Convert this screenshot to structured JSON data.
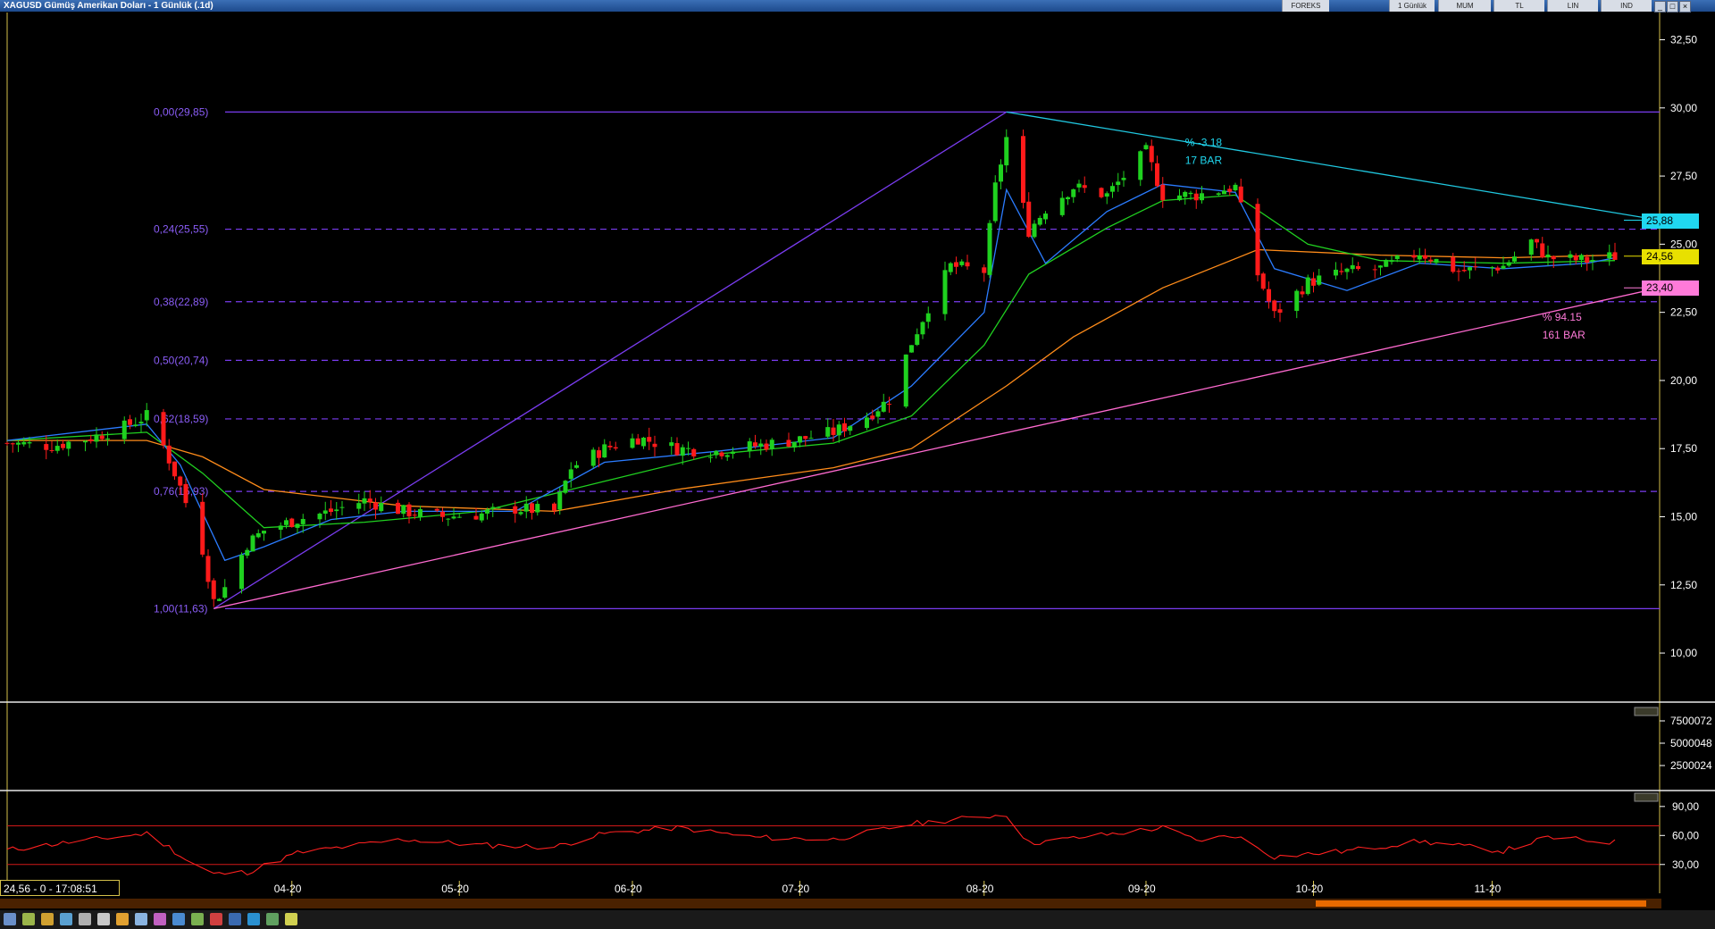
{
  "window": {
    "title": "XAGUSD Gümüş Amerikan Doları - 1 Günlük (.1d)",
    "menu": [
      "FOREKS",
      "1 Günlük",
      "MUM",
      "TL",
      "LIN",
      "IND"
    ]
  },
  "status": {
    "readout": "24,56 - 0 - 17:08:51"
  },
  "price_tags": [
    {
      "label": "25,88",
      "value": 25.88,
      "color": "#20d8f0"
    },
    {
      "label": "24,56",
      "value": 24.56,
      "color": "#e8e000"
    },
    {
      "label": "23,40",
      "value": 23.4,
      "color": "#ff7ad9"
    }
  ],
  "annotations": [
    {
      "line1": "% -3.18",
      "line2": "17 BAR",
      "color": "#20d8f0",
      "date": "2020-09-08",
      "price": 28.6
    },
    {
      "line1": "% 94.15",
      "line2": "161 BAR",
      "color": "#ff7ad9",
      "date": "2020-11-11",
      "price": 22.2
    }
  ],
  "chart_data": [
    {
      "type": "candlestick",
      "title": "",
      "x_ticks": [
        {
          "label": "04-20",
          "date": "2020-04-01"
        },
        {
          "label": "05-20",
          "date": "2020-05-01"
        },
        {
          "label": "06-20",
          "date": "2020-06-01"
        },
        {
          "label": "07-20",
          "date": "2020-07-01"
        },
        {
          "label": "08-20",
          "date": "2020-08-03"
        },
        {
          "label": "09-20",
          "date": "2020-09-01"
        },
        {
          "label": "10-20",
          "date": "2020-10-01"
        },
        {
          "label": "11-20",
          "date": "2020-11-02"
        }
      ],
      "xlim": [
        "2020-02-10",
        "2020-12-02"
      ],
      "y_ticks": [
        "32,50",
        "30,00",
        "27,50",
        "25,00",
        "22,50",
        "20,00",
        "17,50",
        "15,00",
        "12,50",
        "10,00"
      ],
      "y_tick_values": [
        32.5,
        30,
        27.5,
        25,
        22.5,
        20,
        17.5,
        15,
        12.5,
        10
      ],
      "ylim": [
        8.2,
        33.5
      ],
      "colors": {
        "up": "#1fd11f",
        "down": "#ff1a1a",
        "ema_fast": "#2b7cff",
        "ema_mid": "#20d020",
        "ema_slow": "#ff8c1a",
        "fib": "#7a3cf0",
        "support": "#ff6ad0",
        "resistance": "#20c8e0"
      },
      "closes": [
        [
          "2020-02-10",
          17.7
        ],
        [
          "2020-02-18",
          17.6
        ],
        [
          "2020-02-25",
          17.9
        ],
        [
          "2020-03-02",
          18.3
        ],
        [
          "2020-03-06",
          18.7
        ],
        [
          "2020-03-09",
          17.6
        ],
        [
          "2020-03-12",
          16.1
        ],
        [
          "2020-03-16",
          13.8
        ],
        [
          "2020-03-18",
          11.9
        ],
        [
          "2020-03-20",
          12.4
        ],
        [
          "2020-03-24",
          14.0
        ],
        [
          "2020-03-27",
          14.5
        ],
        [
          "2020-04-02",
          14.9
        ],
        [
          "2020-04-08",
          15.2
        ],
        [
          "2020-04-14",
          15.6
        ],
        [
          "2020-04-21",
          15.2
        ],
        [
          "2020-04-28",
          15.0
        ],
        [
          "2020-05-05",
          15.1
        ],
        [
          "2020-05-11",
          15.3
        ],
        [
          "2020-05-18",
          15.2
        ],
        [
          "2020-05-21",
          16.8
        ],
        [
          "2020-05-27",
          17.5
        ],
        [
          "2020-06-02",
          17.9
        ],
        [
          "2020-06-09",
          17.5
        ],
        [
          "2020-06-16",
          17.4
        ],
        [
          "2020-06-23",
          17.6
        ],
        [
          "2020-06-30",
          17.8
        ],
        [
          "2020-07-07",
          18.1
        ],
        [
          "2020-07-13",
          18.7
        ],
        [
          "2020-07-17",
          19.3
        ],
        [
          "2020-07-21",
          21.4
        ],
        [
          "2020-07-24",
          22.7
        ],
        [
          "2020-07-28",
          24.2
        ],
        [
          "2020-08-03",
          24.0
        ],
        [
          "2020-08-05",
          27.1
        ],
        [
          "2020-08-07",
          28.9
        ],
        [
          "2020-08-11",
          25.5
        ],
        [
          "2020-08-14",
          26.3
        ],
        [
          "2020-08-19",
          27.1
        ],
        [
          "2020-08-25",
          26.8
        ],
        [
          "2020-09-01",
          28.4
        ],
        [
          "2020-09-04",
          26.8
        ],
        [
          "2020-09-10",
          26.8
        ],
        [
          "2020-09-17",
          27.1
        ],
        [
          "2020-09-21",
          23.9
        ],
        [
          "2020-09-24",
          22.4
        ],
        [
          "2020-09-30",
          23.6
        ],
        [
          "2020-10-07",
          24.0
        ],
        [
          "2020-10-13",
          24.1
        ],
        [
          "2020-10-20",
          24.7
        ],
        [
          "2020-10-27",
          24.0
        ],
        [
          "2020-11-04",
          24.2
        ],
        [
          "2020-11-09",
          25.1
        ],
        [
          "2020-11-12",
          24.5
        ],
        [
          "2020-11-19",
          24.4
        ],
        [
          "2020-11-24",
          24.56
        ]
      ],
      "ema_fast": [
        [
          "2020-02-10",
          17.8
        ],
        [
          "2020-03-06",
          18.4
        ],
        [
          "2020-03-12",
          16.9
        ],
        [
          "2020-03-20",
          13.4
        ],
        [
          "2020-03-27",
          13.9
        ],
        [
          "2020-04-08",
          14.9
        ],
        [
          "2020-04-21",
          15.2
        ],
        [
          "2020-05-11",
          15.2
        ],
        [
          "2020-05-27",
          17.0
        ],
        [
          "2020-06-16",
          17.4
        ],
        [
          "2020-07-07",
          17.9
        ],
        [
          "2020-07-21",
          19.8
        ],
        [
          "2020-08-03",
          22.5
        ],
        [
          "2020-08-07",
          27.0
        ],
        [
          "2020-08-14",
          24.3
        ],
        [
          "2020-08-25",
          26.2
        ],
        [
          "2020-09-04",
          27.2
        ],
        [
          "2020-09-17",
          26.9
        ],
        [
          "2020-09-24",
          24.1
        ],
        [
          "2020-10-07",
          23.3
        ],
        [
          "2020-10-20",
          24.3
        ],
        [
          "2020-11-04",
          24.1
        ],
        [
          "2020-11-19",
          24.3
        ],
        [
          "2020-11-24",
          24.5
        ]
      ],
      "ema_mid": [
        [
          "2020-02-10",
          17.8
        ],
        [
          "2020-03-06",
          18.1
        ],
        [
          "2020-03-16",
          16.6
        ],
        [
          "2020-03-27",
          14.6
        ],
        [
          "2020-04-14",
          14.8
        ],
        [
          "2020-05-05",
          15.2
        ],
        [
          "2020-05-27",
          16.3
        ],
        [
          "2020-06-16",
          17.3
        ],
        [
          "2020-07-07",
          17.7
        ],
        [
          "2020-07-21",
          18.7
        ],
        [
          "2020-08-03",
          21.3
        ],
        [
          "2020-08-11",
          23.9
        ],
        [
          "2020-08-25",
          25.6
        ],
        [
          "2020-09-04",
          26.6
        ],
        [
          "2020-09-17",
          26.8
        ],
        [
          "2020-09-30",
          25.0
        ],
        [
          "2020-10-13",
          24.4
        ],
        [
          "2020-11-04",
          24.3
        ],
        [
          "2020-11-24",
          24.4
        ]
      ],
      "ema_slow": [
        [
          "2020-02-10",
          17.8
        ],
        [
          "2020-03-06",
          17.8
        ],
        [
          "2020-03-16",
          17.2
        ],
        [
          "2020-03-27",
          16.0
        ],
        [
          "2020-04-21",
          15.4
        ],
        [
          "2020-05-18",
          15.2
        ],
        [
          "2020-06-09",
          16.0
        ],
        [
          "2020-07-07",
          16.8
        ],
        [
          "2020-07-21",
          17.5
        ],
        [
          "2020-08-07",
          19.8
        ],
        [
          "2020-08-19",
          21.6
        ],
        [
          "2020-09-04",
          23.4
        ],
        [
          "2020-09-21",
          24.8
        ],
        [
          "2020-10-13",
          24.6
        ],
        [
          "2020-11-04",
          24.5
        ],
        [
          "2020-11-24",
          24.6
        ]
      ],
      "fibonacci": [
        {
          "label": "0,00(29,85)",
          "value": 29.85
        },
        {
          "label": "0,24(25,55)",
          "value": 25.55
        },
        {
          "label": "0,38(22,89)",
          "value": 22.89
        },
        {
          "label": "0,50(20,74)",
          "value": 20.74
        },
        {
          "label": "0,62(18,59)",
          "value": 18.59
        },
        {
          "label": "0,76(15,93)",
          "value": 15.93
        },
        {
          "label": "1,00(11,63)",
          "value": 11.63
        }
      ],
      "trendlines": [
        {
          "kind": "fib-swing",
          "from": [
            "2020-03-18",
            11.63
          ],
          "to": [
            "2020-08-07",
            29.85
          ]
        },
        {
          "kind": "support",
          "from": [
            "2020-03-18",
            11.63
          ],
          "to": [
            "2020-12-02",
            23.4
          ]
        },
        {
          "kind": "resistance",
          "from": [
            "2020-08-07",
            29.85
          ],
          "to": [
            "2020-12-02",
            25.88
          ]
        }
      ]
    },
    {
      "type": "bar",
      "title": "",
      "y_ticks": [
        "7500072",
        "5000048",
        "2500024"
      ],
      "y_tick_values": [
        7500072,
        5000048,
        2500024
      ]
    },
    {
      "type": "line",
      "title": "",
      "y_ticks": [
        "90,00",
        "60,00",
        "30,00"
      ],
      "y_tick_values": [
        90,
        60,
        30
      ],
      "ylim": [
        15,
        100
      ],
      "levels": [
        70,
        30
      ],
      "values": [
        [
          "2020-02-10",
          45
        ],
        [
          "2020-02-24",
          55
        ],
        [
          "2020-03-06",
          62
        ],
        [
          "2020-03-10",
          48
        ],
        [
          "2020-03-13",
          35
        ],
        [
          "2020-03-18",
          20
        ],
        [
          "2020-03-24",
          22
        ],
        [
          "2020-04-02",
          42
        ],
        [
          "2020-04-21",
          56
        ],
        [
          "2020-05-05",
          50
        ],
        [
          "2020-05-18",
          48
        ],
        [
          "2020-05-27",
          62
        ],
        [
          "2020-06-09",
          68
        ],
        [
          "2020-06-23",
          58
        ],
        [
          "2020-07-07",
          56
        ],
        [
          "2020-07-21",
          72
        ],
        [
          "2020-08-07",
          82
        ],
        [
          "2020-08-11",
          52
        ],
        [
          "2020-08-25",
          61
        ],
        [
          "2020-09-04",
          68
        ],
        [
          "2020-09-10",
          55
        ],
        [
          "2020-09-17",
          60
        ],
        [
          "2020-09-24",
          38
        ],
        [
          "2020-10-07",
          44
        ],
        [
          "2020-10-20",
          54
        ],
        [
          "2020-11-04",
          44
        ],
        [
          "2020-11-12",
          58
        ],
        [
          "2020-11-24",
          53
        ]
      ]
    }
  ]
}
